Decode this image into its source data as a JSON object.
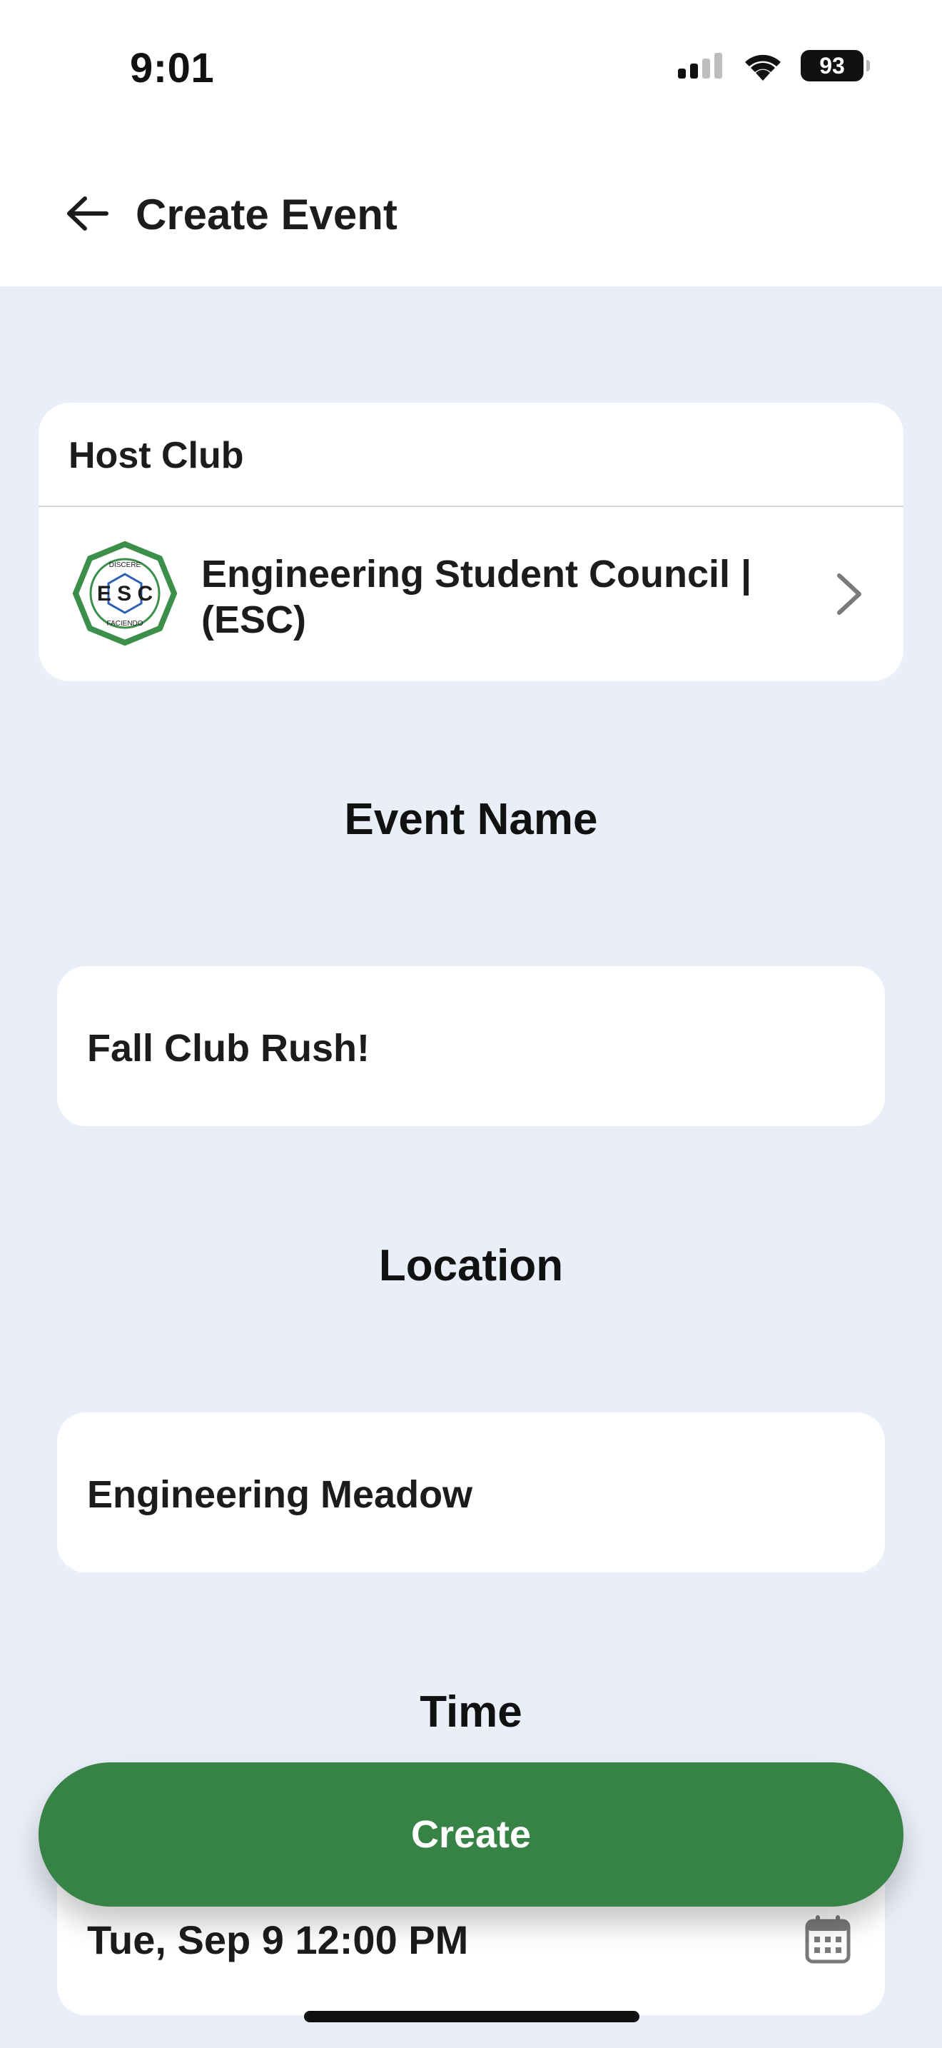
{
  "status_bar": {
    "time": "9:01",
    "battery": "93",
    "icons": [
      "cellular-signal-icon",
      "wifi-icon",
      "battery-icon"
    ]
  },
  "header": {
    "title": "Create Event",
    "back_icon": "arrow-left-icon"
  },
  "host_club": {
    "label": "Host Club",
    "club_name": "Engineering Student Council | (ESC)",
    "logo": {
      "initials": "E S C",
      "top_text": "DISCERE",
      "bottom_text": "FACIENDO",
      "color": "#3c8f4a"
    },
    "chevron_icon": "chevron-right-icon"
  },
  "event_name": {
    "heading": "Event Name",
    "value": "Fall Club Rush!"
  },
  "location": {
    "heading": "Location",
    "value": "Engineering Meadow"
  },
  "time": {
    "heading": "Time",
    "value": "Tue, Sep 9 12:00 PM",
    "icon": "calendar-icon"
  },
  "create_button": {
    "label": "Create",
    "color": "#378245"
  },
  "colors": {
    "background": "#e9eef8",
    "card": "#ffffff",
    "accent": "#378245"
  }
}
